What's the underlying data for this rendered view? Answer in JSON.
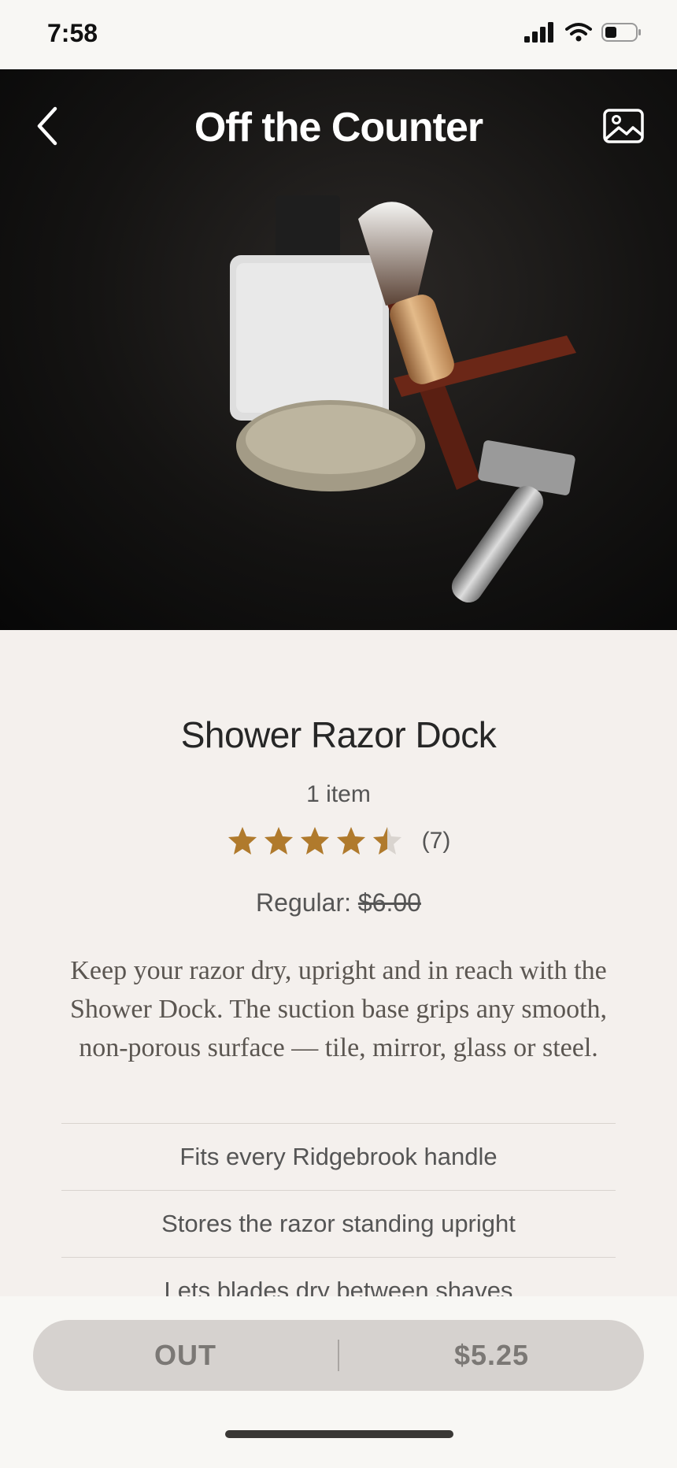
{
  "status": {
    "time": "7:58"
  },
  "header": {
    "title": "Off the Counter"
  },
  "product": {
    "title": "Shower Razor Dock",
    "item_count": "1 item",
    "rating": 4.5,
    "rating_max": 5,
    "rating_count": "(7)",
    "price_label": "Regular: ",
    "regular_price": "$6.00",
    "description": "Keep your razor dry, upright and in reach with the Shower Dock. The suction base grips any smooth, non-porous surface — tile, mirror, glass or steel.",
    "features": [
      "Fits every Ridgebrook handle",
      "Stores the razor standing upright",
      "Lets blades dry between shaves"
    ]
  },
  "buy_bar": {
    "status_label": "OUT",
    "price": "$5.25"
  },
  "colors": {
    "star": "#b07a2c",
    "button_bg": "#d6d2cf"
  },
  "icons": [
    "back-chevron-icon",
    "image-gallery-icon",
    "star-icon",
    "signal-icon",
    "wifi-icon",
    "battery-icon"
  ]
}
